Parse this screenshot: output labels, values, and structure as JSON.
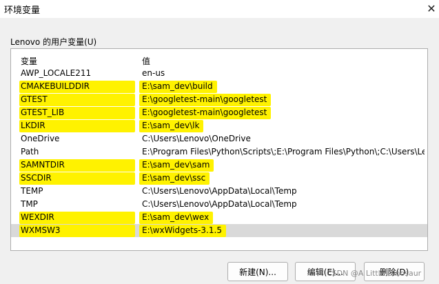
{
  "window": {
    "title": "环境变量",
    "close_glyph": "✕"
  },
  "group": {
    "label": "Lenovo 的用户变量(U)"
  },
  "table": {
    "headers": {
      "name": "变量",
      "value": "值"
    },
    "rows": [
      {
        "name": "AWP_LOCALE211",
        "value": "en-us",
        "highlighted": false,
        "selected": false
      },
      {
        "name": "CMAKEBUILDDIR",
        "value": "E:\\sam_dev\\build",
        "highlighted": true,
        "selected": false
      },
      {
        "name": "GTEST",
        "value": "E:\\googletest-main\\googletest",
        "highlighted": true,
        "selected": false
      },
      {
        "name": "GTEST_LIB",
        "value": "E:\\googletest-main\\googletest",
        "highlighted": true,
        "selected": false
      },
      {
        "name": "LKDIR",
        "value": "E:\\sam_dev\\lk",
        "highlighted": true,
        "selected": false
      },
      {
        "name": "OneDrive",
        "value": "C:\\Users\\Lenovo\\OneDrive",
        "highlighted": false,
        "selected": false
      },
      {
        "name": "Path",
        "value": "E:\\Program Files\\Python\\Scripts\\;E:\\Program Files\\Python\\;C:\\Users\\Le...",
        "highlighted": false,
        "selected": false
      },
      {
        "name": "SAMNTDIR",
        "value": "E:\\sam_dev\\sam",
        "highlighted": true,
        "selected": false
      },
      {
        "name": "SSCDIR",
        "value": "E:\\sam_dev\\ssc",
        "highlighted": true,
        "selected": false
      },
      {
        "name": "TEMP",
        "value": "C:\\Users\\Lenovo\\AppData\\Local\\Temp",
        "highlighted": false,
        "selected": false
      },
      {
        "name": "TMP",
        "value": "C:\\Users\\Lenovo\\AppData\\Local\\Temp",
        "highlighted": false,
        "selected": false
      },
      {
        "name": "WEXDIR",
        "value": "E:\\sam_dev\\wex",
        "highlighted": true,
        "selected": false
      },
      {
        "name": "WXMSW3",
        "value": "E:\\wxWidgets-3.1.5",
        "highlighted": true,
        "selected": true
      }
    ]
  },
  "buttons": {
    "new_label": "新建(N)...",
    "edit_label": "编辑(E)...",
    "delete_label": "删除(D)"
  },
  "watermark": "CSDN @A Little Dinosaur",
  "colors": {
    "highlight": "#fff200",
    "selected_row": "#d9d9d9",
    "background": "#f0f0f0"
  }
}
